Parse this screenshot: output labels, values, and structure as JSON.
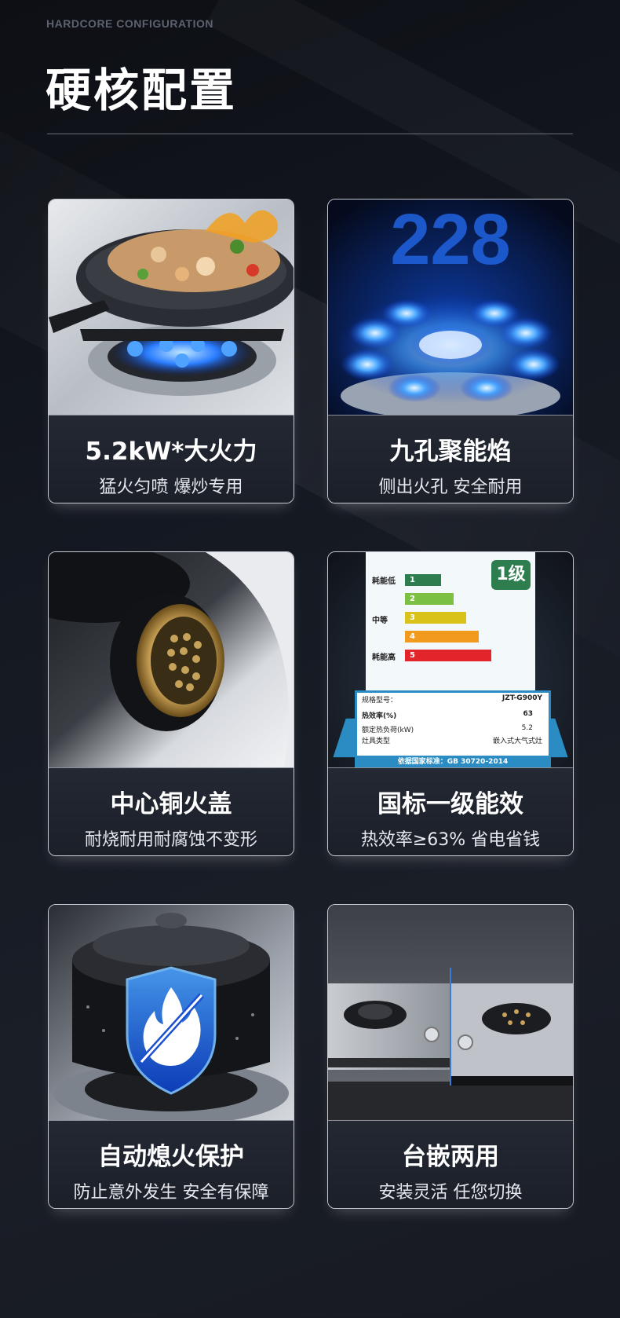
{
  "header": {
    "eyebrow": "HARDCORE CONFIGURATION",
    "title": "硬核配置"
  },
  "features": [
    {
      "title": "5.2kW*大火力",
      "subtitle": "猛火匀喷 爆炒专用",
      "image": "wok-on-blue-flame-burner"
    },
    {
      "title": "九孔聚能焰",
      "subtitle": "侧出火孔 安全耐用",
      "image": "nine-hole-blue-flame",
      "overlay_text": "228"
    },
    {
      "title": "中心铜火盖",
      "subtitle": "耐烧耐用耐腐蚀不变形",
      "image": "copper-burner-cap"
    },
    {
      "title": "国标一级能效",
      "subtitle": "热效率≥63% 省电省钱",
      "image": "energy-efficiency-label"
    },
    {
      "title": "自动熄火保护",
      "subtitle": "防止意外发生 安全有保障",
      "image": "pot-with-flame-shield"
    },
    {
      "title": "台嵌两用",
      "subtitle": "安装灵活 任您切换",
      "image": "countertop-and-built-in-stove"
    }
  ],
  "energy_label": {
    "badge": "1级",
    "low": "耗能低",
    "mid": "中等",
    "high": "耗能高",
    "grades": [
      "1",
      "2",
      "3",
      "4",
      "5"
    ],
    "model_label": "规格型号：",
    "model": "JZT-G900Y",
    "eff_label": "热效率(%)",
    "eff": "63",
    "load_label": "额定热负荷(kW)",
    "load": "5.2",
    "type_label": "灶具类型",
    "type": "嵌入式大气式灶",
    "standard": "依据国家标准：GB 30720-2014"
  },
  "colors": {
    "background": "#141821",
    "card_border": "#c7cad2",
    "flame_blue": "#1e6cff",
    "grade_colors": [
      "#2e7d4f",
      "#7bc043",
      "#e0c21a",
      "#f29a1d",
      "#e2242b"
    ]
  }
}
